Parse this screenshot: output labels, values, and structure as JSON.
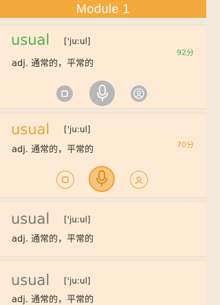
{
  "header": {
    "title": "Module 1"
  },
  "cards": [
    {
      "word": "usual",
      "phonetic": "['ju:ul]",
      "meaning": "adj. 通常的，平常的",
      "score": "92分",
      "word_color": "#4caf50",
      "score_color": "#4caf50"
    },
    {
      "word": "usual",
      "phonetic": "['ju:ul]",
      "meaning": "adj. 通常的，平常的",
      "score": "70分",
      "word_color": "#e8a330",
      "score_color": "#e8a330"
    },
    {
      "word": "usual",
      "phonetic": "['ju:ul]",
      "meaning": "adj. 通常的，平常的",
      "word_color": "#777777"
    },
    {
      "word": "usual",
      "phonetic": "['ju:ul]",
      "meaning": "adj. 通常的，平常的",
      "word_color": "#777777"
    }
  ],
  "icons": {
    "stop": "stop-icon",
    "mic": "microphone-icon",
    "user": "user-icon"
  },
  "colors": {
    "accent": "#f3a93c",
    "card_bg": "#fdebd6",
    "grey_button": "#b7b7b7",
    "orange_button": "#f0a12f"
  }
}
